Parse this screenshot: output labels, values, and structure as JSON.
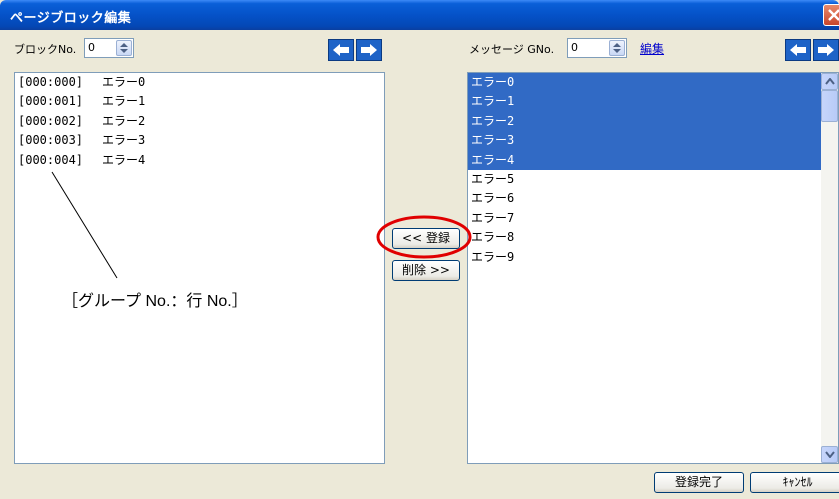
{
  "window": {
    "title": "ページブロック編集"
  },
  "left_panel": {
    "block_label": "ブロックNo.",
    "block_value": "0",
    "items": [
      {
        "code": "[000:000]",
        "text": "エラー0"
      },
      {
        "code": "[000:001]",
        "text": "エラー1"
      },
      {
        "code": "[000:002]",
        "text": "エラー2"
      },
      {
        "code": "[000:003]",
        "text": "エラー3"
      },
      {
        "code": "[000:004]",
        "text": "エラー4"
      }
    ]
  },
  "middle": {
    "register_label": "<< 登録",
    "delete_label": "削除 >>"
  },
  "right_panel": {
    "gno_label": "メッセージ GNo.",
    "gno_value": "0",
    "edit_link": "編集",
    "items": [
      {
        "text": "エラー0",
        "selected": true
      },
      {
        "text": "エラー1",
        "selected": true
      },
      {
        "text": "エラー2",
        "selected": true
      },
      {
        "text": "エラー3",
        "selected": true
      },
      {
        "text": "エラー4",
        "selected": true
      },
      {
        "text": "エラー5",
        "selected": false
      },
      {
        "text": "エラー6",
        "selected": false
      },
      {
        "text": "エラー7",
        "selected": false
      },
      {
        "text": "エラー8",
        "selected": false
      },
      {
        "text": "エラー9",
        "selected": false
      }
    ]
  },
  "footer": {
    "complete_label": "登録完了",
    "cancel_label": "ｷｬﾝｾﾙ"
  },
  "annotation": {
    "text": "［グループ No.：行 No.］",
    "highlight_color": "#e00000"
  },
  "colors": {
    "selection": "#316ac5",
    "titlebar": "#0552c8"
  }
}
